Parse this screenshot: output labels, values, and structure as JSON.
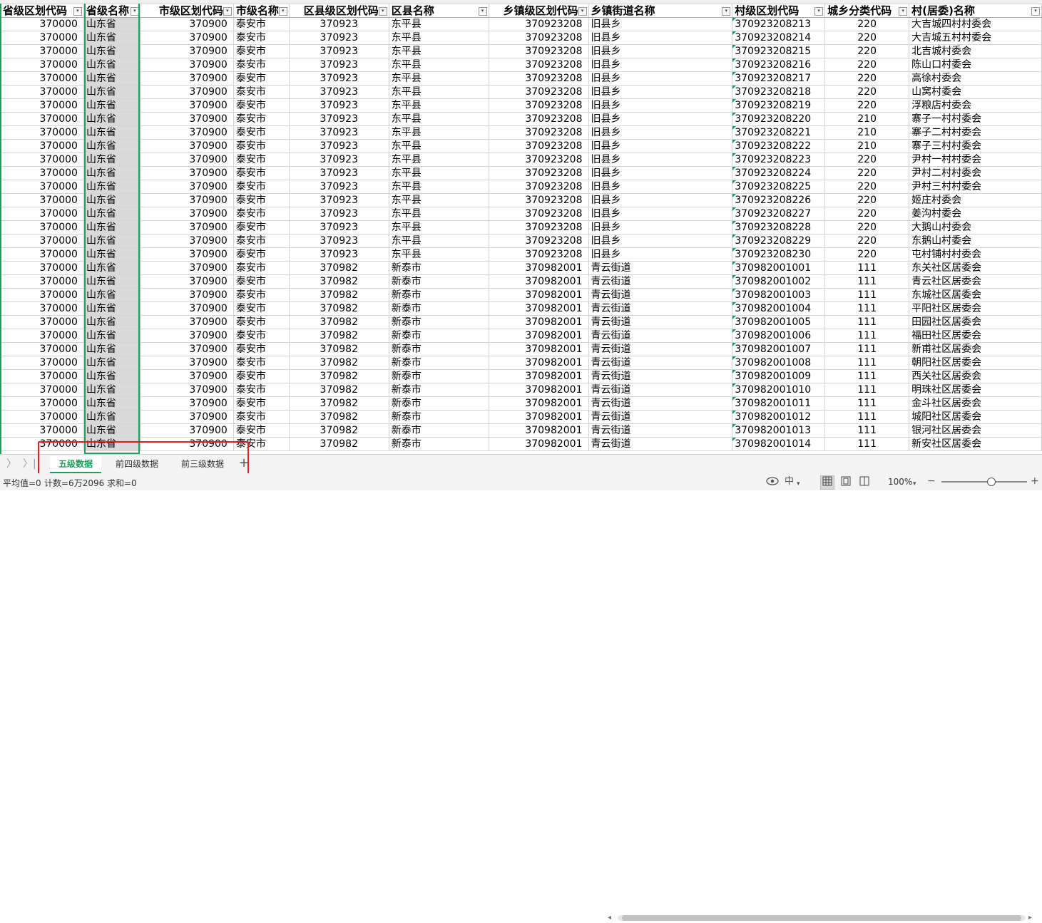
{
  "sheet": {
    "headers": [
      "省级区划代码",
      "省级名称",
      "市级区划代码",
      "市级名称",
      "区县级区划代码",
      "区县名称",
      "乡镇级区划代码",
      "乡镇街道名称",
      "村级区划代码",
      "城乡分类代码",
      "村(居委)名称"
    ],
    "filter_glyph": "▾",
    "rows": [
      [
        "370000",
        "山东省",
        "370900",
        "泰安市",
        "370923",
        "东平县",
        "370923208",
        "旧县乡",
        "370923208213",
        "220",
        "大吉城四村村委会"
      ],
      [
        "370000",
        "山东省",
        "370900",
        "泰安市",
        "370923",
        "东平县",
        "370923208",
        "旧县乡",
        "370923208214",
        "220",
        "大吉城五村村委会"
      ],
      [
        "370000",
        "山东省",
        "370900",
        "泰安市",
        "370923",
        "东平县",
        "370923208",
        "旧县乡",
        "370923208215",
        "220",
        "北吉城村委会"
      ],
      [
        "370000",
        "山东省",
        "370900",
        "泰安市",
        "370923",
        "东平县",
        "370923208",
        "旧县乡",
        "370923208216",
        "220",
        "陈山口村委会"
      ],
      [
        "370000",
        "山东省",
        "370900",
        "泰安市",
        "370923",
        "东平县",
        "370923208",
        "旧县乡",
        "370923208217",
        "220",
        "高徐村委会"
      ],
      [
        "370000",
        "山东省",
        "370900",
        "泰安市",
        "370923",
        "东平县",
        "370923208",
        "旧县乡",
        "370923208218",
        "220",
        "山窝村委会"
      ],
      [
        "370000",
        "山东省",
        "370900",
        "泰安市",
        "370923",
        "东平县",
        "370923208",
        "旧县乡",
        "370923208219",
        "220",
        "浮粮店村委会"
      ],
      [
        "370000",
        "山东省",
        "370900",
        "泰安市",
        "370923",
        "东平县",
        "370923208",
        "旧县乡",
        "370923208220",
        "210",
        "寨子一村村委会"
      ],
      [
        "370000",
        "山东省",
        "370900",
        "泰安市",
        "370923",
        "东平县",
        "370923208",
        "旧县乡",
        "370923208221",
        "210",
        "寨子二村村委会"
      ],
      [
        "370000",
        "山东省",
        "370900",
        "泰安市",
        "370923",
        "东平县",
        "370923208",
        "旧县乡",
        "370923208222",
        "210",
        "寨子三村村委会"
      ],
      [
        "370000",
        "山东省",
        "370900",
        "泰安市",
        "370923",
        "东平县",
        "370923208",
        "旧县乡",
        "370923208223",
        "220",
        "尹村一村村委会"
      ],
      [
        "370000",
        "山东省",
        "370900",
        "泰安市",
        "370923",
        "东平县",
        "370923208",
        "旧县乡",
        "370923208224",
        "220",
        "尹村二村村委会"
      ],
      [
        "370000",
        "山东省",
        "370900",
        "泰安市",
        "370923",
        "东平县",
        "370923208",
        "旧县乡",
        "370923208225",
        "220",
        "尹村三村村委会"
      ],
      [
        "370000",
        "山东省",
        "370900",
        "泰安市",
        "370923",
        "东平县",
        "370923208",
        "旧县乡",
        "370923208226",
        "220",
        "姬庄村委会"
      ],
      [
        "370000",
        "山东省",
        "370900",
        "泰安市",
        "370923",
        "东平县",
        "370923208",
        "旧县乡",
        "370923208227",
        "220",
        "姜沟村委会"
      ],
      [
        "370000",
        "山东省",
        "370900",
        "泰安市",
        "370923",
        "东平县",
        "370923208",
        "旧县乡",
        "370923208228",
        "220",
        "大鹅山村委会"
      ],
      [
        "370000",
        "山东省",
        "370900",
        "泰安市",
        "370923",
        "东平县",
        "370923208",
        "旧县乡",
        "370923208229",
        "220",
        "东鹅山村委会"
      ],
      [
        "370000",
        "山东省",
        "370900",
        "泰安市",
        "370923",
        "东平县",
        "370923208",
        "旧县乡",
        "370923208230",
        "220",
        "屯村铺村村委会"
      ],
      [
        "370000",
        "山东省",
        "370900",
        "泰安市",
        "370982",
        "新泰市",
        "370982001",
        "青云街道",
        "370982001001",
        "111",
        "东关社区居委会"
      ],
      [
        "370000",
        "山东省",
        "370900",
        "泰安市",
        "370982",
        "新泰市",
        "370982001",
        "青云街道",
        "370982001002",
        "111",
        "青云社区居委会"
      ],
      [
        "370000",
        "山东省",
        "370900",
        "泰安市",
        "370982",
        "新泰市",
        "370982001",
        "青云街道",
        "370982001003",
        "111",
        "东城社区居委会"
      ],
      [
        "370000",
        "山东省",
        "370900",
        "泰安市",
        "370982",
        "新泰市",
        "370982001",
        "青云街道",
        "370982001004",
        "111",
        "平阳社区居委会"
      ],
      [
        "370000",
        "山东省",
        "370900",
        "泰安市",
        "370982",
        "新泰市",
        "370982001",
        "青云街道",
        "370982001005",
        "111",
        "田园社区居委会"
      ],
      [
        "370000",
        "山东省",
        "370900",
        "泰安市",
        "370982",
        "新泰市",
        "370982001",
        "青云街道",
        "370982001006",
        "111",
        "福田社区居委会"
      ],
      [
        "370000",
        "山东省",
        "370900",
        "泰安市",
        "370982",
        "新泰市",
        "370982001",
        "青云街道",
        "370982001007",
        "111",
        "新甫社区居委会"
      ],
      [
        "370000",
        "山东省",
        "370900",
        "泰安市",
        "370982",
        "新泰市",
        "370982001",
        "青云街道",
        "370982001008",
        "111",
        "朝阳社区居委会"
      ],
      [
        "370000",
        "山东省",
        "370900",
        "泰安市",
        "370982",
        "新泰市",
        "370982001",
        "青云街道",
        "370982001009",
        "111",
        "西关社区居委会"
      ],
      [
        "370000",
        "山东省",
        "370900",
        "泰安市",
        "370982",
        "新泰市",
        "370982001",
        "青云街道",
        "370982001010",
        "111",
        "明珠社区居委会"
      ],
      [
        "370000",
        "山东省",
        "370900",
        "泰安市",
        "370982",
        "新泰市",
        "370982001",
        "青云街道",
        "370982001011",
        "111",
        "金斗社区居委会"
      ],
      [
        "370000",
        "山东省",
        "370900",
        "泰安市",
        "370982",
        "新泰市",
        "370982001",
        "青云街道",
        "370982001012",
        "111",
        "城阳社区居委会"
      ],
      [
        "370000",
        "山东省",
        "370900",
        "泰安市",
        "370982",
        "新泰市",
        "370982001",
        "青云街道",
        "370982001013",
        "111",
        "银河社区居委会"
      ],
      [
        "370000",
        "山东省",
        "370900",
        "泰安市",
        "370982",
        "新泰市",
        "370982001",
        "青云街道",
        "370982001014",
        "111",
        "新安社区居委会"
      ]
    ]
  },
  "tabs": {
    "nav_prev": "〉",
    "nav_last": "〉|",
    "items": [
      "五级数据",
      "前四级数据",
      "前三级数据"
    ],
    "add": "+"
  },
  "status": {
    "average": "平均值=0",
    "count": "计数=6万2096",
    "sum": "求和=0",
    "ime": "中",
    "zoom": "100%"
  },
  "colors": {
    "accent": "#1e9f5c",
    "highlight": "#e02020",
    "selected_column": "#d9d9d9"
  }
}
